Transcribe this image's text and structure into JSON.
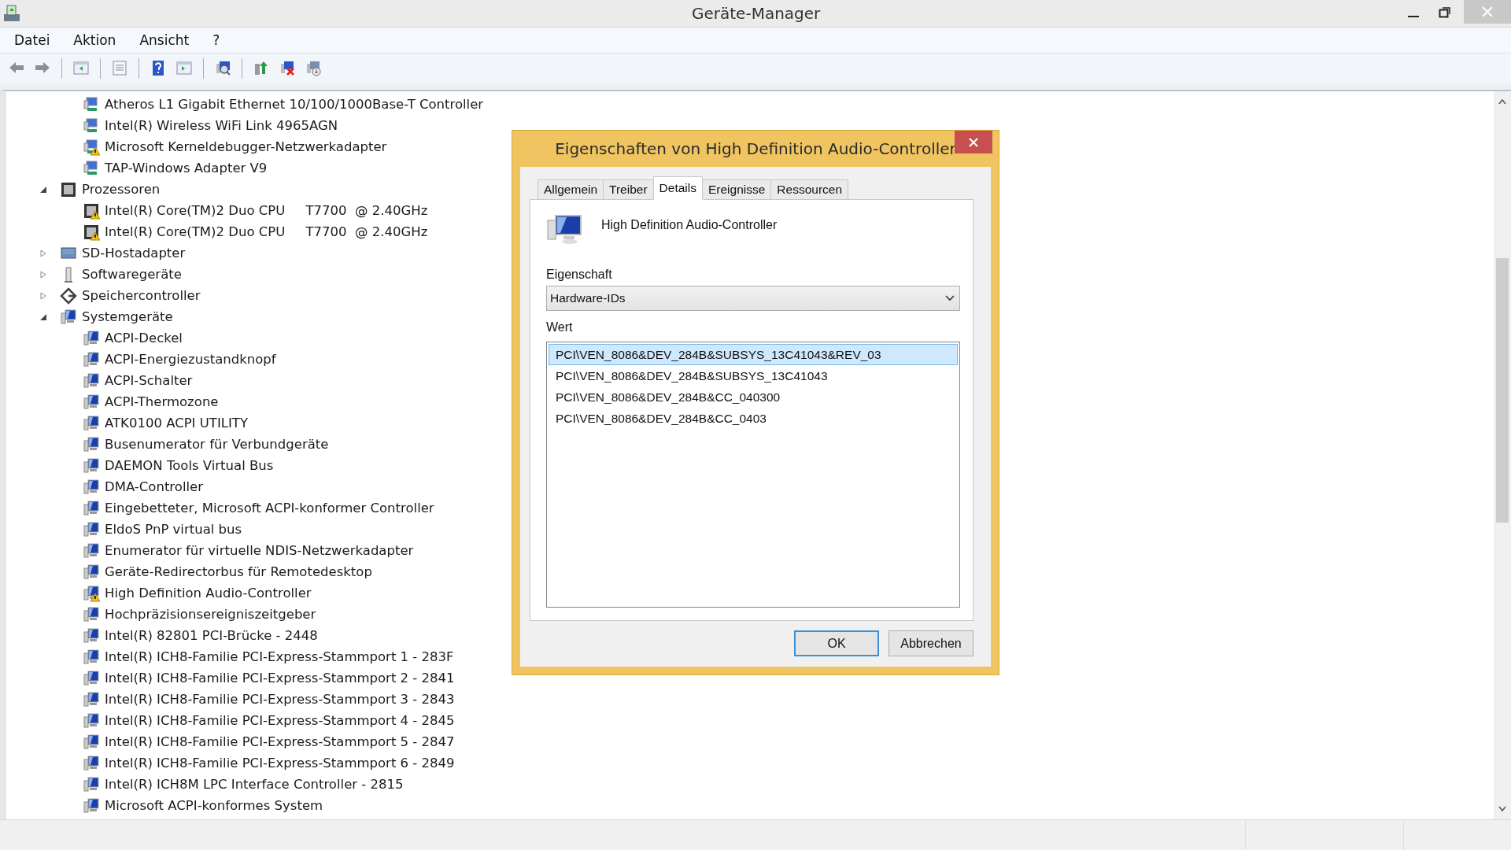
{
  "window": {
    "title": "Geräte-Manager"
  },
  "menu": [
    "Datei",
    "Aktion",
    "Ansicht",
    "?"
  ],
  "toolbar": [
    {
      "kind": "back"
    },
    {
      "kind": "forward"
    },
    {
      "kind": "sep"
    },
    {
      "kind": "pane"
    },
    {
      "kind": "sep"
    },
    {
      "kind": "props"
    },
    {
      "kind": "sep"
    },
    {
      "kind": "help"
    },
    {
      "kind": "pane2"
    },
    {
      "kind": "sep"
    },
    {
      "kind": "scan"
    },
    {
      "kind": "sep"
    },
    {
      "kind": "update"
    },
    {
      "kind": "uninstall"
    },
    {
      "kind": "disable"
    }
  ],
  "tree": [
    {
      "children": [
        {
          "label": "Atheros L1 Gigabit Ethernet 10/100/1000Base-T Controller",
          "kind": "network",
          "warning": false
        },
        {
          "label": "Intel(R) Wireless WiFi Link 4965AGN",
          "kind": "network",
          "warning": false
        },
        {
          "label": "Microsoft Kerneldebugger-Netzwerkadapter",
          "kind": "network",
          "warning": true
        },
        {
          "label": "TAP-Windows Adapter V9",
          "kind": "network",
          "warning": false
        }
      ]
    },
    {
      "label": "Prozessoren",
      "kind": "cpu",
      "warning": false,
      "expanded": true,
      "children": [
        {
          "label": "Intel(R) Core(TM)2 Duo CPU     T7700  @ 2.40GHz",
          "kind": "cpu",
          "warning": true
        },
        {
          "label": "Intel(R) Core(TM)2 Duo CPU     T7700  @ 2.40GHz",
          "kind": "cpu",
          "warning": true
        }
      ]
    },
    {
      "label": "SD-Hostadapter",
      "kind": "card",
      "warning": false,
      "expanded": false
    },
    {
      "label": "Softwaregeräte",
      "kind": "software",
      "warning": false,
      "expanded": false
    },
    {
      "label": "Speichercontroller",
      "kind": "storage",
      "warning": false,
      "expanded": false
    },
    {
      "label": "Systemgeräte",
      "kind": "system",
      "warning": false,
      "expanded": true,
      "children": [
        {
          "label": "ACPI-Deckel",
          "kind": "system",
          "warning": false
        },
        {
          "label": "ACPI-Energiezustandknopf",
          "kind": "system",
          "warning": false
        },
        {
          "label": "ACPI-Schalter",
          "kind": "system",
          "warning": false
        },
        {
          "label": "ACPI-Thermozone",
          "kind": "system",
          "warning": false
        },
        {
          "label": "ATK0100 ACPI UTILITY",
          "kind": "system",
          "warning": false
        },
        {
          "label": "Busenumerator für Verbundgeräte",
          "kind": "system",
          "warning": false
        },
        {
          "label": "DAEMON Tools Virtual Bus",
          "kind": "system",
          "warning": false
        },
        {
          "label": "DMA-Controller",
          "kind": "system",
          "warning": false
        },
        {
          "label": "Eingebetteter, Microsoft ACPI-konformer Controller",
          "kind": "system",
          "warning": false
        },
        {
          "label": "EldoS PnP virtual bus",
          "kind": "system",
          "warning": false
        },
        {
          "label": "Enumerator für virtuelle NDIS-Netzwerkadapter",
          "kind": "system",
          "warning": false
        },
        {
          "label": "Geräte-Redirectorbus für Remotedesktop",
          "kind": "system",
          "warning": false
        },
        {
          "label": "High Definition Audio-Controller",
          "kind": "system",
          "warning": true
        },
        {
          "label": "Hochpräzisionsereigniszeitgeber",
          "kind": "system",
          "warning": false
        },
        {
          "label": "Intel(R) 82801 PCI-Brücke - 2448",
          "kind": "system",
          "warning": false
        },
        {
          "label": "Intel(R) ICH8-Familie PCI-Express-Stammport 1 - 283F",
          "kind": "system",
          "warning": false
        },
        {
          "label": "Intel(R) ICH8-Familie PCI-Express-Stammport 2 - 2841",
          "kind": "system",
          "warning": false
        },
        {
          "label": "Intel(R) ICH8-Familie PCI-Express-Stammport 3 - 2843",
          "kind": "system",
          "warning": false
        },
        {
          "label": "Intel(R) ICH8-Familie PCI-Express-Stammport 4 - 2845",
          "kind": "system",
          "warning": false
        },
        {
          "label": "Intel(R) ICH8-Familie PCI-Express-Stammport 5 - 2847",
          "kind": "system",
          "warning": false
        },
        {
          "label": "Intel(R) ICH8-Familie PCI-Express-Stammport 6 - 2849",
          "kind": "system",
          "warning": false
        },
        {
          "label": "Intel(R) ICH8M LPC Interface Controller - 2815",
          "kind": "system",
          "warning": false
        },
        {
          "label": "Microsoft ACPI-konformes System",
          "kind": "system",
          "warning": false
        }
      ]
    }
  ],
  "dialog": {
    "title": "Eigenschaften von High Definition Audio-Controller",
    "tabs": [
      {
        "label": "Allgemein",
        "selected": false
      },
      {
        "label": "Treiber",
        "selected": false
      },
      {
        "label": "Details",
        "selected": true
      },
      {
        "label": "Ereignisse",
        "selected": false
      },
      {
        "label": "Ressourcen",
        "selected": false
      }
    ],
    "device_name": "High Definition Audio-Controller",
    "property_label": "Eigenschaft",
    "property_value": "Hardware-IDs",
    "value_label": "Wert",
    "values": [
      {
        "text": "PCI\\VEN_8086&DEV_284B&SUBSYS_13C41043&REV_03",
        "selected": true
      },
      {
        "text": "PCI\\VEN_8086&DEV_284B&SUBSYS_13C41043",
        "selected": false
      },
      {
        "text": "PCI\\VEN_8086&DEV_284B&CC_040300",
        "selected": false
      },
      {
        "text": "PCI\\VEN_8086&DEV_284B&CC_0403",
        "selected": false
      }
    ],
    "buttons": [
      {
        "label": "OK",
        "default": true
      },
      {
        "label": "Abbrechen",
        "default": false
      }
    ]
  }
}
